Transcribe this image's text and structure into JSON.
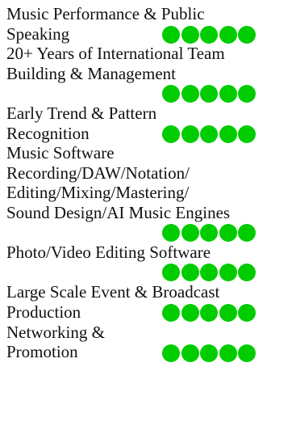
{
  "skills": [
    {
      "name": "Music Performance & Public\nSpeaking",
      "rating": 5,
      "rating_line": "inline"
    },
    {
      "name": "20+ Years of International Team\nBuilding & Management",
      "rating": 5,
      "rating_line": "own"
    },
    {
      "name": "Early Trend & Pattern\nRecognition",
      "rating": 5,
      "rating_line": "inline"
    },
    {
      "name": "Music Software\nRecording/DAW/Notation/\nEditing/Mixing/Mastering/\nSound Design/AI Music Engines",
      "rating": 5,
      "rating_line": "own"
    },
    {
      "name": "Photo/Video Editing Software",
      "rating": 5,
      "rating_line": "own"
    },
    {
      "name": "Large Scale Event & Broadcast\nProduction",
      "rating": 5,
      "rating_line": "inline"
    },
    {
      "name": "Networking &\nPromotion",
      "rating": 5,
      "rating_line": "inline"
    }
  ],
  "colors": {
    "rating_dot": "#00cc00",
    "text": "#111111"
  },
  "icons": {
    "rating_dot": "green-circle-icon"
  }
}
